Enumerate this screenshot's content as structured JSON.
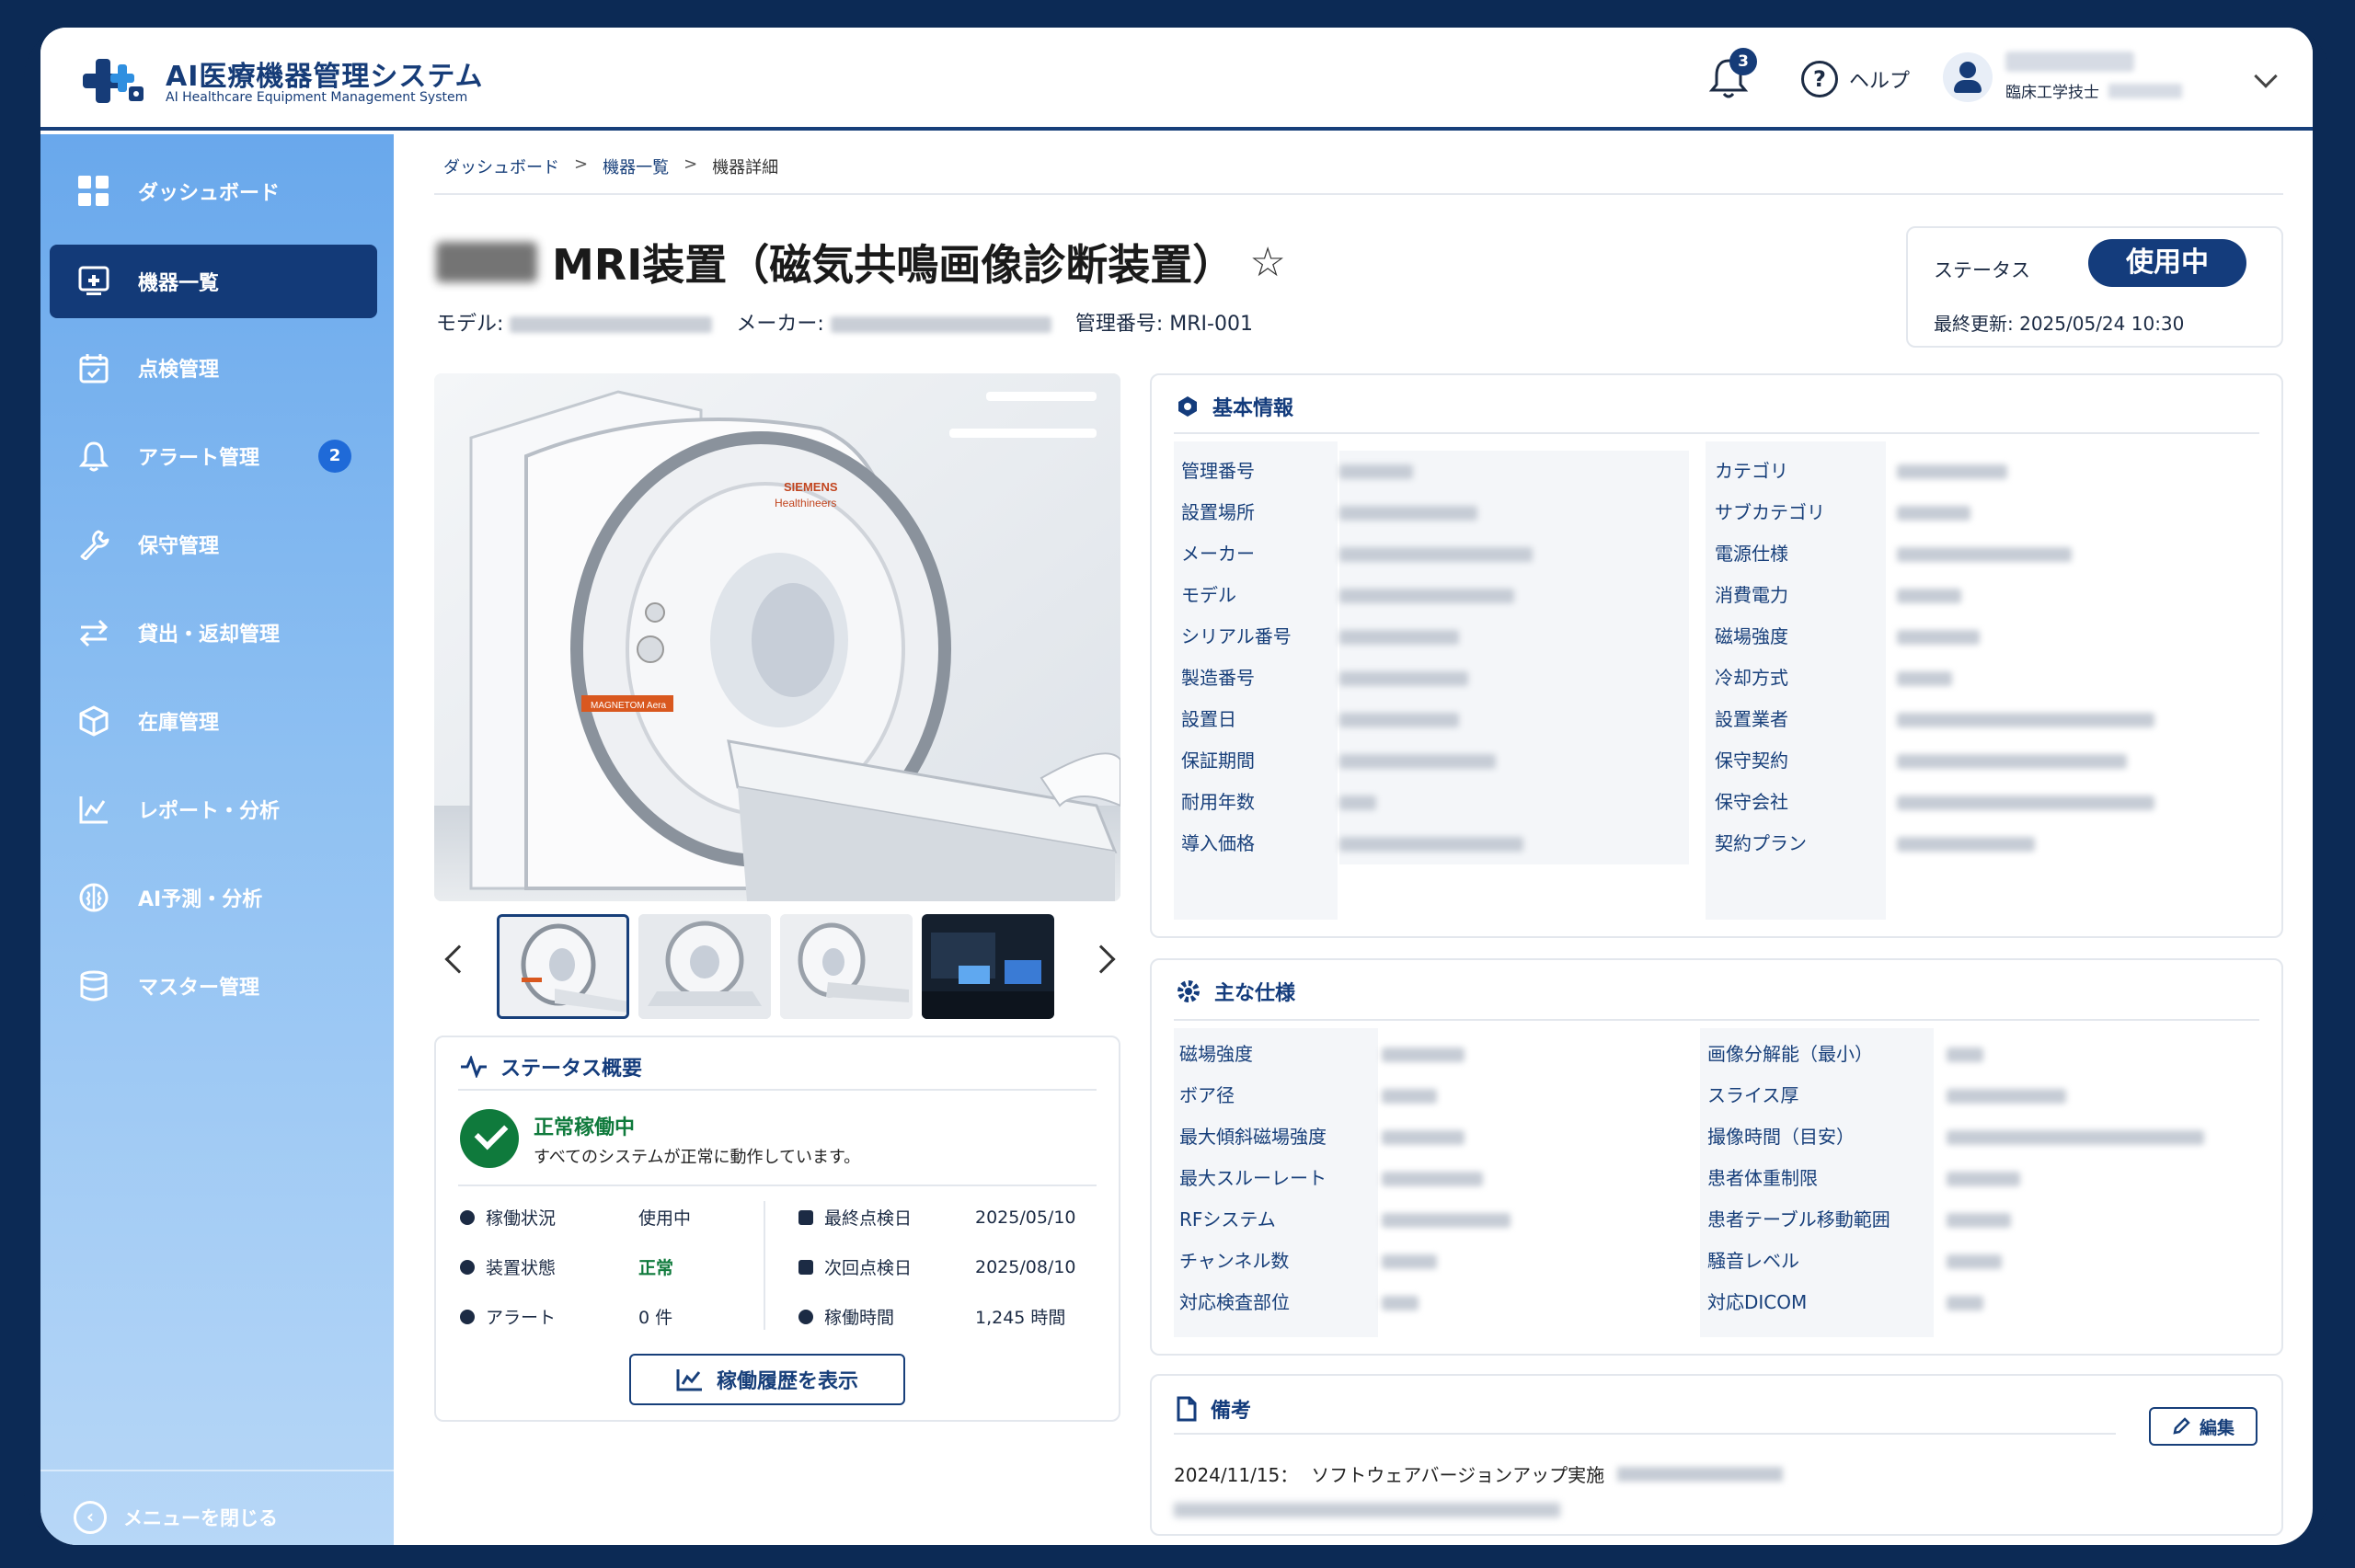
{
  "app": {
    "title": "AI医療機器管理システム",
    "subtitle": "AI Healthcare Equipment Management System"
  },
  "header": {
    "notification_count": "3",
    "help_label": "ヘルプ",
    "user_role": "臨床工学技士"
  },
  "sidebar": {
    "items": [
      {
        "label": "ダッシュボード",
        "icon": "grid-icon"
      },
      {
        "label": "機器一覧",
        "icon": "device-list-icon"
      },
      {
        "label": "点検管理",
        "icon": "calendar-check-icon"
      },
      {
        "label": "アラート管理",
        "icon": "bell-icon",
        "badge": "2"
      },
      {
        "label": "保守管理",
        "icon": "wrench-icon"
      },
      {
        "label": "貸出・返却管理",
        "icon": "exchange-icon"
      },
      {
        "label": "在庫管理",
        "icon": "box-icon"
      },
      {
        "label": "レポート・分析",
        "icon": "chart-icon"
      },
      {
        "label": "AI予測・分析",
        "icon": "brain-icon"
      },
      {
        "label": "マスター管理",
        "icon": "database-icon"
      }
    ],
    "close_label": "メニューを閉じる"
  },
  "breadcrumb": {
    "items": [
      "ダッシュボード",
      "機器一覧",
      "機器詳細"
    ],
    "separator": ">"
  },
  "device": {
    "title": "MRI装置（磁気共鳴画像診断装置）",
    "model_label": "モデル:",
    "maker_label": "メーカー:",
    "id_label": "管理番号:",
    "id_value": "MRI-001"
  },
  "status_box": {
    "label": "ステータス",
    "value": "使用中",
    "updated_label": "最終更新:",
    "updated_value": "2025/05/24 10:30"
  },
  "status_overview": {
    "title": "ステータス概要",
    "headline": "正常稼働中",
    "message": "すべてのシステムが正常に動作しています。",
    "left": [
      {
        "label": "稼働状況",
        "value": "使用中"
      },
      {
        "label": "装置状態",
        "value": "正常"
      },
      {
        "label": "アラート",
        "value": "0 件"
      }
    ],
    "right": [
      {
        "label": "最終点検日",
        "value": "2025/05/10"
      },
      {
        "label": "次回点検日",
        "value": "2025/08/10"
      },
      {
        "label": "稼働時間",
        "value": "1,245 時間"
      }
    ],
    "history_button": "稼働履歴を表示"
  },
  "basic_info": {
    "title": "基本情報",
    "left_labels": [
      "管理番号",
      "設置場所",
      "メーカー",
      "モデル",
      "シリアル番号",
      "製造番号",
      "設置日",
      "保証期間",
      "耐用年数",
      "導入価格"
    ],
    "right_labels": [
      "カテゴリ",
      "サブカテゴリ",
      "電源仕様",
      "消費電力",
      "磁場強度",
      "冷却方式",
      "設置業者",
      "保守契約",
      "保守会社",
      "契約プラン"
    ]
  },
  "specs": {
    "title": "主な仕様",
    "left_labels": [
      "磁場強度",
      "ボア径",
      "最大傾斜磁場強度",
      "最大スルーレート",
      "RFシステム",
      "チャンネル数",
      "対応検査部位"
    ],
    "right_labels": [
      "画像分解能（最小）",
      "スライス厚",
      "撮像時間（目安）",
      "患者体重制限",
      "患者テーブル移動範囲",
      "騒音レベル",
      "対応DICOM"
    ]
  },
  "notes": {
    "title": "備考",
    "edit_label": "編集",
    "entry_date": "2024/11/15：",
    "entry_text": "ソフトウェアバージョンアップ実施"
  },
  "colors": {
    "navy": "#143c7c",
    "green": "#0f7a3c",
    "accent_blue": "#1f6ad8"
  }
}
